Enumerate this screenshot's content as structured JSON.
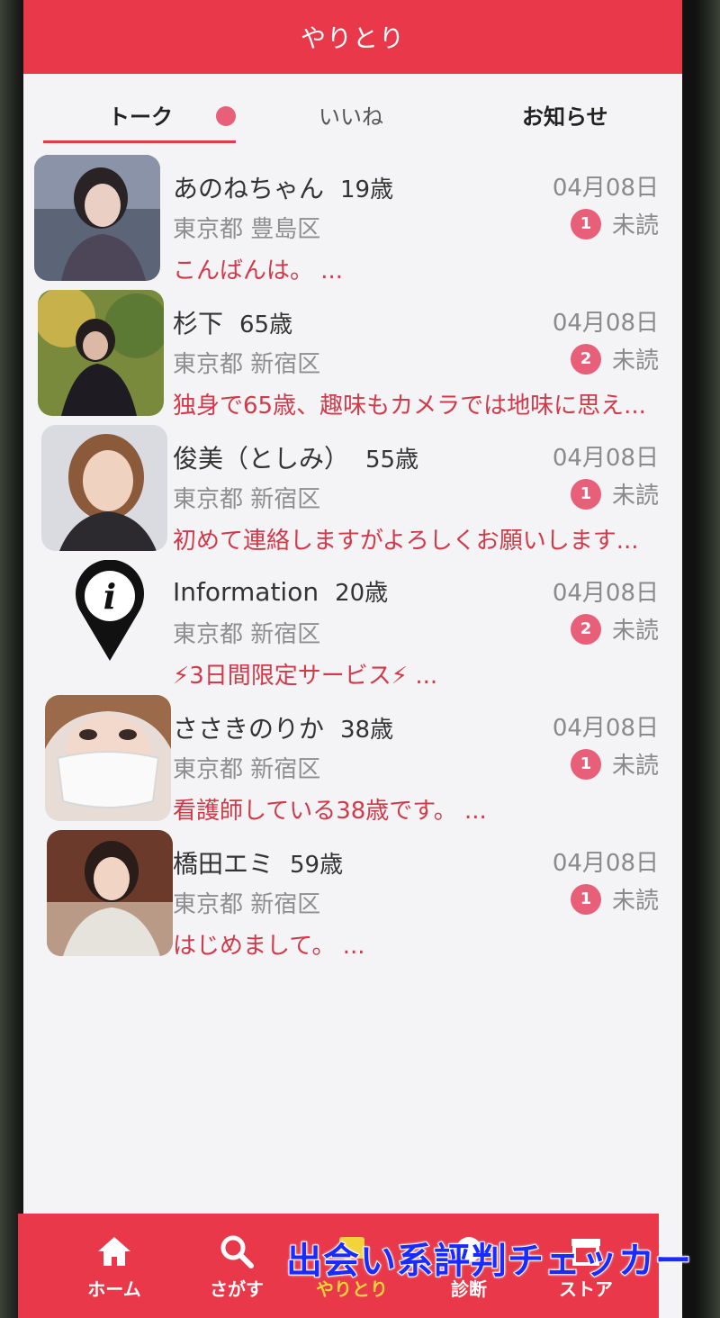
{
  "header": {
    "title": "やりとり"
  },
  "tabs": [
    {
      "label": "トーク",
      "active": true,
      "has_dot": true
    },
    {
      "label": "いいね",
      "active": false
    },
    {
      "label": "お知らせ",
      "active": false
    }
  ],
  "conversations": [
    {
      "name": "あのねちゃん",
      "age": "19歳",
      "area": "東京都 豊島区",
      "date": "04月08日",
      "unread_count": "1",
      "unread_label": "未読",
      "message": "こんばんは。 ...",
      "avatar": "photo"
    },
    {
      "name": "杉下",
      "age": "65歳",
      "area": "東京都 新宿区",
      "date": "04月08日",
      "unread_count": "2",
      "unread_label": "未読",
      "message": "独身で65歳、趣味もカメラでは地味に思え...",
      "avatar": "photo"
    },
    {
      "name": "俊美（としみ）",
      "age": "55歳",
      "area": "東京都 新宿区",
      "date": "04月08日",
      "unread_count": "1",
      "unread_label": "未読",
      "message": "初めて連絡しますがよろしくお願いします...",
      "avatar": "photo"
    },
    {
      "name": "Information",
      "age": "20歳",
      "area": "東京都 新宿区",
      "date": "04月08日",
      "unread_count": "2",
      "unread_label": "未読",
      "message": "⚡3日間限定サービス⚡ ...",
      "avatar": "info-pin-icon"
    },
    {
      "name": "ささきのりか",
      "age": "38歳",
      "area": "東京都 新宿区",
      "date": "04月08日",
      "unread_count": "1",
      "unread_label": "未読",
      "message": "看護師している38歳です。 ...",
      "avatar": "photo"
    },
    {
      "name": "橋田エミ",
      "age": "59歳",
      "area": "東京都 新宿区",
      "date": "04月08日",
      "unread_count": "1",
      "unread_label": "未読",
      "message": "はじめまして。 ...",
      "avatar": "photo"
    }
  ],
  "bottom_nav": [
    {
      "label": "ホーム",
      "icon": "home-icon",
      "active": false
    },
    {
      "label": "さがす",
      "icon": "search-icon",
      "active": false
    },
    {
      "label": "やりとり",
      "icon": "chat-icon",
      "active": true
    },
    {
      "label": "診断",
      "icon": "diagnosis-icon",
      "active": false
    },
    {
      "label": "ストア",
      "icon": "store-icon",
      "active": false
    }
  ],
  "watermark": "出会い系評判チェッカー",
  "colors": {
    "accent": "#e8384a",
    "badge": "#e85f7a",
    "message": "#d13a4a",
    "nav_active": "#f4d23a"
  }
}
